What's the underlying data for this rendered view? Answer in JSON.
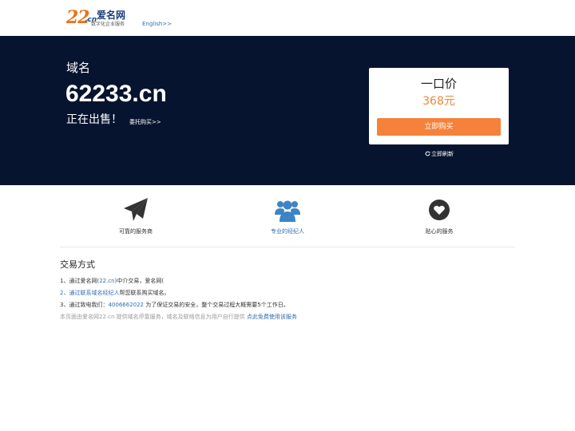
{
  "header": {
    "logo_number": "22",
    "logo_cn": ".cn",
    "logo_name": "爱名网",
    "logo_slogan": "数字化企业服务",
    "lang_link": "English>>"
  },
  "banner": {
    "domain_label": "域名",
    "domain_name": "62233.cn",
    "for_sale": "正在出售！",
    "entrust_link": "委托购买>>",
    "price_title": "一口价",
    "price_value": "368元",
    "buy_button": "立即购买",
    "refresh_link": "立即刷新"
  },
  "features": [
    {
      "label": "可靠的服务商",
      "icon": "paper-plane-icon"
    },
    {
      "label": "专业的经纪人",
      "icon": "users-icon"
    },
    {
      "label": "贴心的服务",
      "icon": "heart-icon"
    }
  ],
  "trade": {
    "title": "交易方式",
    "step1": {
      "num": "1、",
      "pre": "通过爱名网(",
      "link": "22.cn",
      "post": ")中介交易，爱名网("
    },
    "step2": {
      "num": "2、",
      "pre": "通过",
      "link": "联系域名经纪人",
      "post": "帮您联系购买域名。"
    },
    "step3": {
      "num": "3、",
      "pre": "通过致电我们：",
      "link": "4006662022",
      "post": " 为了保证交易的安全，整个交易过程大概需要5个工作日。"
    },
    "footnote": {
      "pre": "本页面由爱名网22.cn 提供域名停靠服务，域名及联络信息为用户自行提供 ",
      "link": "点此免费使用该服务"
    }
  },
  "colors": {
    "banner_bg": "#06142f",
    "accent_orange": "#f5813a",
    "link_blue": "#2f6db5"
  }
}
